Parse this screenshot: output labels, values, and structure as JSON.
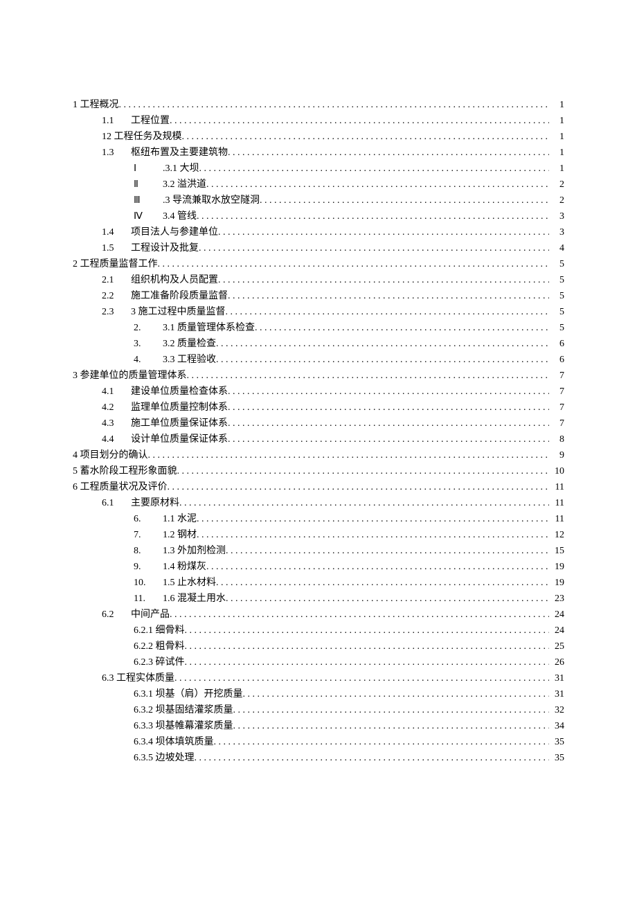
{
  "toc": [
    {
      "indent": 0,
      "label": "",
      "title": "1 工程概况",
      "page": "1"
    },
    {
      "indent": 1,
      "label": "1.1",
      "title": "工程位置",
      "page": "1"
    },
    {
      "indent": 1,
      "label": "",
      "title": "12 工程任务及规模",
      "page": "1"
    },
    {
      "indent": 1,
      "label": "1.3",
      "title": "枢纽布置及主要建筑物",
      "page": "1"
    },
    {
      "indent": 2,
      "label": "Ⅰ",
      "title": ".3.1 大坝",
      "page": "1"
    },
    {
      "indent": 2,
      "label": "Ⅱ",
      "title": "3.2 溢洪道",
      "page": "2"
    },
    {
      "indent": 2,
      "label": "Ⅲ",
      "title": ".3 导流兼取水放空隧洞",
      "page": "2"
    },
    {
      "indent": 2,
      "label": "Ⅳ",
      "title": "3.4 管线",
      "page": "3"
    },
    {
      "indent": 1,
      "label": "1.4",
      "title": "项目法人与参建单位",
      "page": "3"
    },
    {
      "indent": 1,
      "label": "1.5",
      "title": "工程设计及批复",
      "page": "4"
    },
    {
      "indent": 0,
      "label": "",
      "title": "2 工程质量监督工作",
      "page": "5"
    },
    {
      "indent": 1,
      "label": "2.1",
      "title": "组织机构及人员配置",
      "page": "5"
    },
    {
      "indent": 1,
      "label": "2.2",
      "title": "施工准备阶段质量监督",
      "page": "5"
    },
    {
      "indent": 1,
      "label": "2.3",
      "title": "3 施工过程中质量监督",
      "page": "5"
    },
    {
      "indent": 2,
      "label": "2.",
      "title": "3.1 质量管理体系检查",
      "page": "5"
    },
    {
      "indent": 2,
      "label": "3.",
      "title": "3.2 质量检查",
      "page": "6"
    },
    {
      "indent": 2,
      "label": "4.",
      "title": "3.3 工程验收",
      "page": "6"
    },
    {
      "indent": 0,
      "label": "",
      "title": "3 参建单位的质量管理体系",
      "page": "7"
    },
    {
      "indent": 1,
      "label": "4.1",
      "title": "建设单位质量检查体系",
      "page": "7"
    },
    {
      "indent": 1,
      "label": "4.2",
      "title": "监理单位质量控制体系",
      "page": "7"
    },
    {
      "indent": 1,
      "label": "4.3",
      "title": "施工单位质量保证体系",
      "page": "7"
    },
    {
      "indent": 1,
      "label": "4.4",
      "title": "设计单位质量保证体系",
      "page": "8"
    },
    {
      "indent": 0,
      "label": "",
      "title": "4 项目划分的确认",
      "page": "9"
    },
    {
      "indent": 0,
      "label": "",
      "title": "5 蓄水阶段工程形象面貌",
      "page": "10"
    },
    {
      "indent": 0,
      "label": "",
      "title": "6 工程质量状况及评价",
      "page": "11"
    },
    {
      "indent": 1,
      "label": "6.1",
      "title": "主要原材料",
      "page": "11"
    },
    {
      "indent": 2,
      "label": "6.",
      "title": "1.1 水泥",
      "page": "11"
    },
    {
      "indent": 2,
      "label": "7.",
      "title": "1.2 钢材",
      "page": "12"
    },
    {
      "indent": 2,
      "label": "8.",
      "title": "1.3 外加剂检测",
      "page": "15"
    },
    {
      "indent": 2,
      "label": "9.",
      "title": "1.4 粉煤灰",
      "page": "19"
    },
    {
      "indent": 2,
      "label": "10.",
      "title": "1.5 止水材料",
      "page": "19"
    },
    {
      "indent": 2,
      "label": "11.",
      "title": "1.6 混凝土用水",
      "page": "23"
    },
    {
      "indent": 1,
      "label": "6.2",
      "title": "中间产品",
      "page": "24"
    },
    {
      "indent": 2,
      "label": "",
      "title": "6.2.1 细骨料",
      "page": "24"
    },
    {
      "indent": 2,
      "label": "",
      "title": "6.2.2 粗骨料",
      "page": "25"
    },
    {
      "indent": 2,
      "label": "",
      "title": "6.2.3 碎试件",
      "page": "26"
    },
    {
      "indent": 1,
      "label": "",
      "title": "6.3 工程实体质量",
      "page": "31"
    },
    {
      "indent": 2,
      "label": "",
      "title": "6.3.1 坝基（肩）开挖质量",
      "page": "31"
    },
    {
      "indent": 2,
      "label": "",
      "title": "6.3.2 坝基固结灌浆质量",
      "page": "32"
    },
    {
      "indent": 2,
      "label": "",
      "title": "6.3.3 坝基帷幕灌浆质量",
      "page": "34"
    },
    {
      "indent": 2,
      "label": "",
      "title": "6.3.4 坝体填筑质量",
      "page": "35"
    },
    {
      "indent": 2,
      "label": "",
      "title": "6.3.5 边坡处理",
      "page": "35"
    }
  ]
}
